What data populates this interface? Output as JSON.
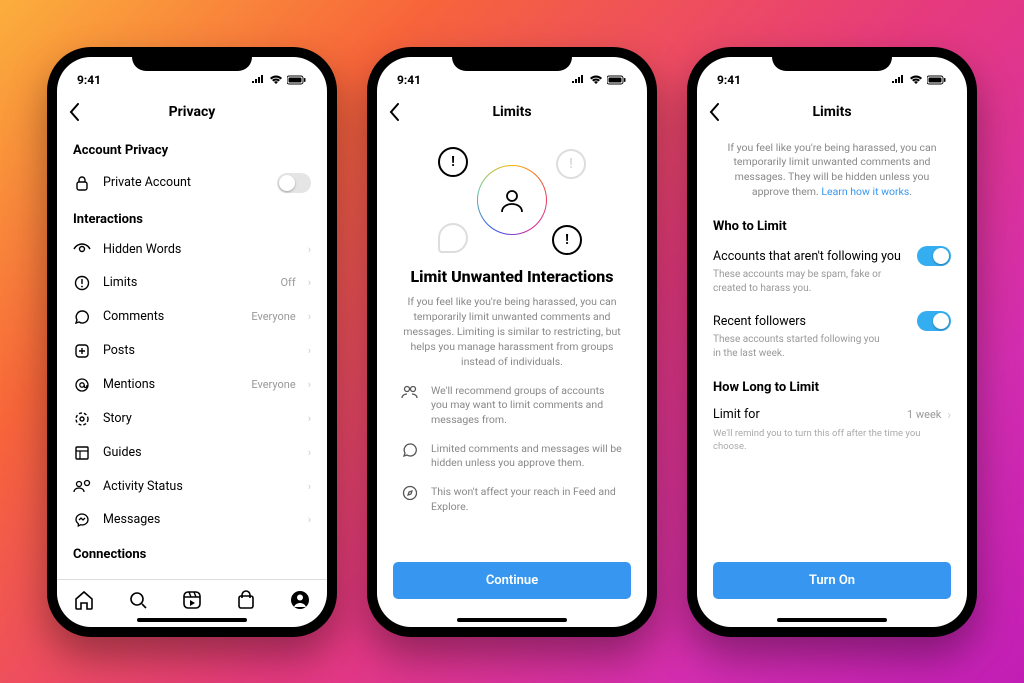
{
  "status_time": "9:41",
  "phone1": {
    "title": "Privacy",
    "section_account": "Account Privacy",
    "private_account": "Private Account",
    "section_interactions": "Interactions",
    "rows": [
      {
        "icon": "eye",
        "label": "Hidden Words",
        "value": ""
      },
      {
        "icon": "limits",
        "label": "Limits",
        "value": "Off"
      },
      {
        "icon": "comment",
        "label": "Comments",
        "value": "Everyone"
      },
      {
        "icon": "plus",
        "label": "Posts",
        "value": ""
      },
      {
        "icon": "at",
        "label": "Mentions",
        "value": "Everyone"
      },
      {
        "icon": "story",
        "label": "Story",
        "value": ""
      },
      {
        "icon": "guides",
        "label": "Guides",
        "value": ""
      },
      {
        "icon": "activity",
        "label": "Activity Status",
        "value": ""
      },
      {
        "icon": "messages",
        "label": "Messages",
        "value": ""
      }
    ],
    "section_connections": "Connections"
  },
  "phone2": {
    "title": "Limits",
    "heading": "Limit Unwanted Interactions",
    "intro": "If you feel like you're being harassed, you can temporarily limit unwanted comments and messages. Limiting is similar to restricting, but helps you manage harassment from groups instead of individuals.",
    "bullets": [
      "We'll recommend groups of accounts you may want to limit comments and messages from.",
      "Limited comments and messages will be hidden unless you approve them.",
      "This won't affect your reach in Feed and Explore."
    ],
    "cta": "Continue"
  },
  "phone3": {
    "title": "Limits",
    "intro_a": "If you feel like you're being harassed, you can temporarily limit unwanted comments and messages. They will be hidden unless you approve them. ",
    "intro_link": "Learn how it works",
    "section_who": "Who to Limit",
    "opt1_title": "Accounts that aren't following you",
    "opt1_desc": "These accounts may be spam, fake or created to harass you.",
    "opt2_title": "Recent followers",
    "opt2_desc": "These accounts started following you in the last week.",
    "section_howlong": "How Long to Limit",
    "limitfor_label": "Limit for",
    "limitfor_value": "1 week",
    "footnote": "We'll remind you to turn this off after the time you choose.",
    "cta": "Turn On"
  }
}
